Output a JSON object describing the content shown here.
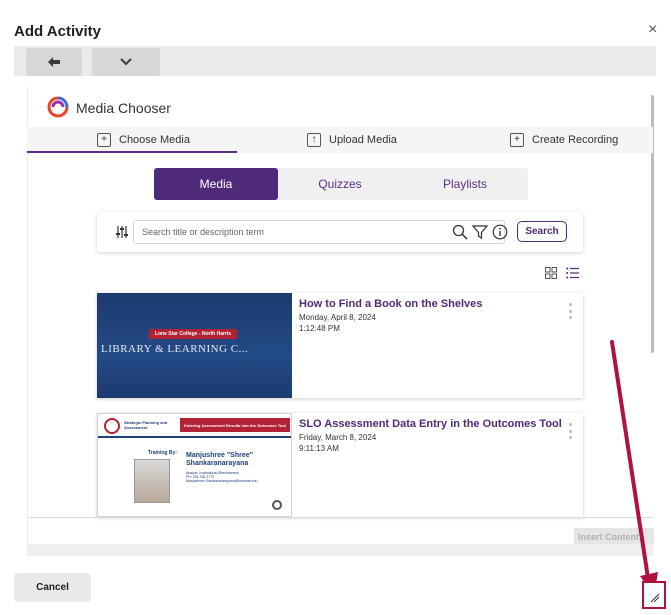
{
  "dialog": {
    "title": "Add Activity",
    "close_symbol": "×"
  },
  "media_chooser": {
    "title": "Media Chooser",
    "tabs": [
      {
        "label": "Choose Media",
        "icon": "plus-box-icon",
        "glyph": "+"
      },
      {
        "label": "Upload Media",
        "icon": "upload-box-icon",
        "glyph": "↑"
      },
      {
        "label": "Create Recording",
        "icon": "plus-tag-icon",
        "glyph": "+"
      }
    ],
    "segments": [
      "Media",
      "Quizzes",
      "Playlists"
    ],
    "search": {
      "placeholder": "Search title or description term",
      "button": "Search"
    }
  },
  "media_items": [
    {
      "title": "How to Find a Book on the Shelves",
      "date": "Monday, April 8, 2024",
      "time": "1:12:48 PM",
      "thumb": {
        "banner": "Lone Star College - North Harris",
        "caption": "LIBRARY & LEARNING C..."
      }
    },
    {
      "title": "SLO Assessment Data Entry in the Outcomes Tool",
      "date": "Friday, March 8, 2024",
      "time": "9:11:13 AM",
      "thumb": {
        "org": "Strategic Planning and Assessment",
        "banner": "Entering Assessment Results into the Outcomes Tool",
        "training_by": "Training By:",
        "presenter": "Manjushree \"Shree\" Shankaranarayana",
        "presenter_role": "Analyst, Institutional Effectiveness",
        "presenter_phone": "PH: 281.290.2772",
        "presenter_email": "Manjushree.Shankaranarayana@lonestar.edu"
      }
    }
  ],
  "footer": {
    "insert_label": "Insert Content",
    "cancel_label": "Cancel"
  },
  "colors": {
    "accent_purple": "#4f2a7a",
    "annotation_red": "#b0123f",
    "thumb_navy": "#1c3a6e"
  }
}
